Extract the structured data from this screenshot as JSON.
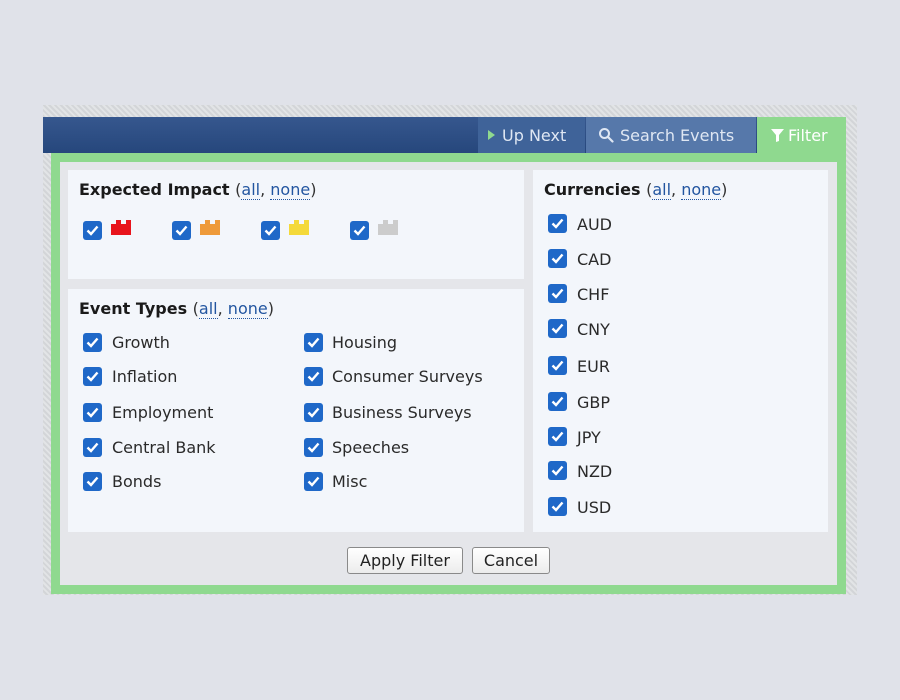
{
  "nav": {
    "tabs": [
      {
        "label": "Up Next",
        "icon": "play-icon"
      },
      {
        "label": "Search Events",
        "icon": "search-icon"
      },
      {
        "label": "Filter",
        "icon": "funnel-icon",
        "active": true
      }
    ]
  },
  "expected_impact": {
    "title": "Expected Impact",
    "all_label": "all",
    "none_label": "none",
    "levels": [
      {
        "color": "#e8141c",
        "checked": true
      },
      {
        "color": "#ee9a3a",
        "checked": true
      },
      {
        "color": "#f4d93a",
        "checked": true
      },
      {
        "color": "#cccccc",
        "checked": true
      }
    ]
  },
  "event_types": {
    "title": "Event Types",
    "all_label": "all",
    "none_label": "none",
    "items": [
      {
        "label": "Growth",
        "checked": true
      },
      {
        "label": "Housing",
        "checked": true
      },
      {
        "label": "Inflation",
        "checked": true
      },
      {
        "label": "Consumer Surveys",
        "checked": true
      },
      {
        "label": "Employment",
        "checked": true
      },
      {
        "label": "Business Surveys",
        "checked": true
      },
      {
        "label": "Central Bank",
        "checked": true
      },
      {
        "label": "Speeches",
        "checked": true
      },
      {
        "label": "Bonds",
        "checked": true
      },
      {
        "label": "Misc",
        "checked": true
      }
    ]
  },
  "currencies": {
    "title": "Currencies",
    "all_label": "all",
    "none_label": "none",
    "items": [
      {
        "label": "AUD",
        "checked": true
      },
      {
        "label": "CAD",
        "checked": true
      },
      {
        "label": "CHF",
        "checked": true
      },
      {
        "label": "CNY",
        "checked": true
      },
      {
        "label": "EUR",
        "checked": true
      },
      {
        "label": "GBP",
        "checked": true
      },
      {
        "label": "JPY",
        "checked": true
      },
      {
        "label": "NZD",
        "checked": true
      },
      {
        "label": "USD",
        "checked": true
      }
    ]
  },
  "actions": {
    "apply_label": "Apply Filter",
    "cancel_label": "Cancel"
  },
  "colors": {
    "nav_bar": "#26477c",
    "active_tab": "#8fd98f",
    "panel_border": "#8fd98f",
    "checkbox": "#1f68c8",
    "link": "#2255a0"
  }
}
